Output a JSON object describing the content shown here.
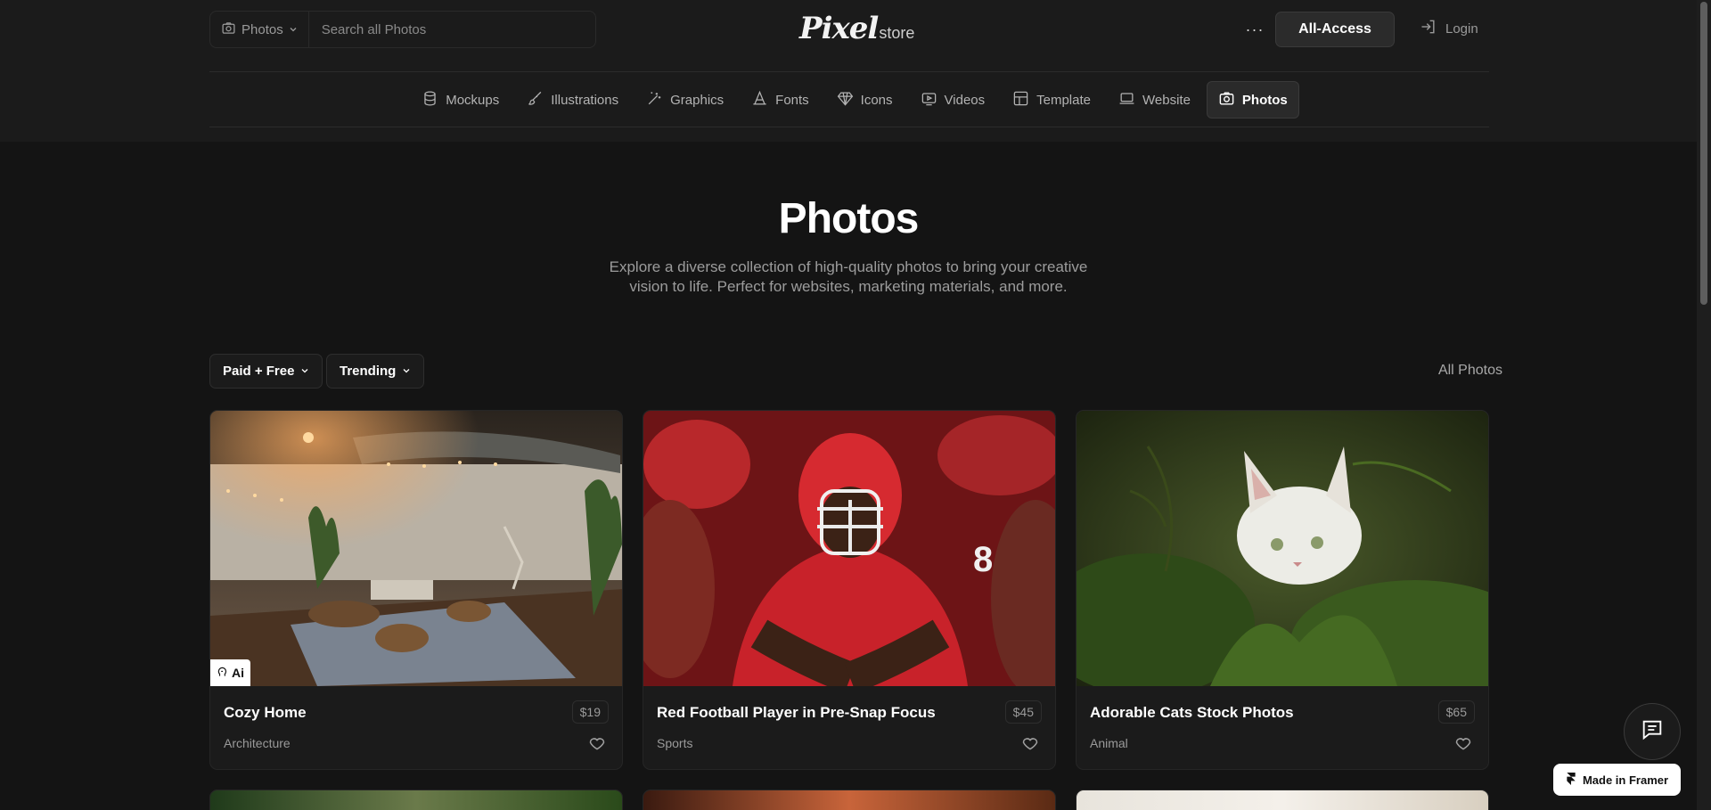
{
  "header": {
    "search_category": "Photos",
    "search_placeholder": "Search all Photos",
    "logo_main": "Pixel",
    "logo_sub": "store",
    "more_label": "···",
    "all_access_label": "All-Access",
    "login_label": "Login"
  },
  "categories": [
    {
      "label": "Mockups",
      "icon": "database-icon"
    },
    {
      "label": "Illustrations",
      "icon": "brush-icon"
    },
    {
      "label": "Graphics",
      "icon": "magic-wand-icon"
    },
    {
      "label": "Fonts",
      "icon": "font-icon"
    },
    {
      "label": "Icons",
      "icon": "diamond-icon"
    },
    {
      "label": "Videos",
      "icon": "video-icon"
    },
    {
      "label": "Template",
      "icon": "grid-icon"
    },
    {
      "label": "Website",
      "icon": "laptop-icon"
    },
    {
      "label": "Photos",
      "icon": "camera-icon",
      "active": true
    }
  ],
  "hero": {
    "title": "Photos",
    "description": "Explore a diverse collection of high-quality photos to bring your creative vision to life. Perfect for websites, marketing materials, and more."
  },
  "filters": {
    "price_filter": "Paid + Free",
    "sort": "Trending",
    "all_label": "All Photos"
  },
  "products": [
    {
      "title": "Cozy Home",
      "price": "$19",
      "category": "Architecture",
      "badge": "Ai"
    },
    {
      "title": "Red Football Player in Pre-Snap Focus",
      "price": "$45",
      "category": "Sports"
    },
    {
      "title": "Adorable Cats Stock Photos",
      "price": "$65",
      "category": "Animal"
    }
  ],
  "footer": {
    "framer_label": "Made in Framer"
  },
  "colors": {
    "background": "#141414",
    "header_bg": "#1b1b1b",
    "accent_active": "#2a2a2a"
  }
}
